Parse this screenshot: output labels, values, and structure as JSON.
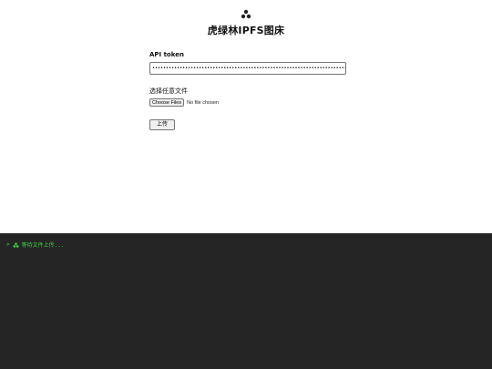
{
  "header": {
    "logo_icon": "triple-cluster-icon",
    "title": "虎绿林IPFS图床"
  },
  "form": {
    "token_label": "API token",
    "token_value": "••••••••••••••••••••••••••••••••••••••••••••••••••••••••••••••••••••••••••••••",
    "file_label": "选择任意文件",
    "choose_files_label": "Choose Files",
    "no_file_text": "No file chosen",
    "upload_label": "上传"
  },
  "console": {
    "prompt": ">",
    "icon": "triple-cluster-icon",
    "message": "等待文件上传...",
    "text_color": "#3ad43a",
    "background": "#252525"
  }
}
